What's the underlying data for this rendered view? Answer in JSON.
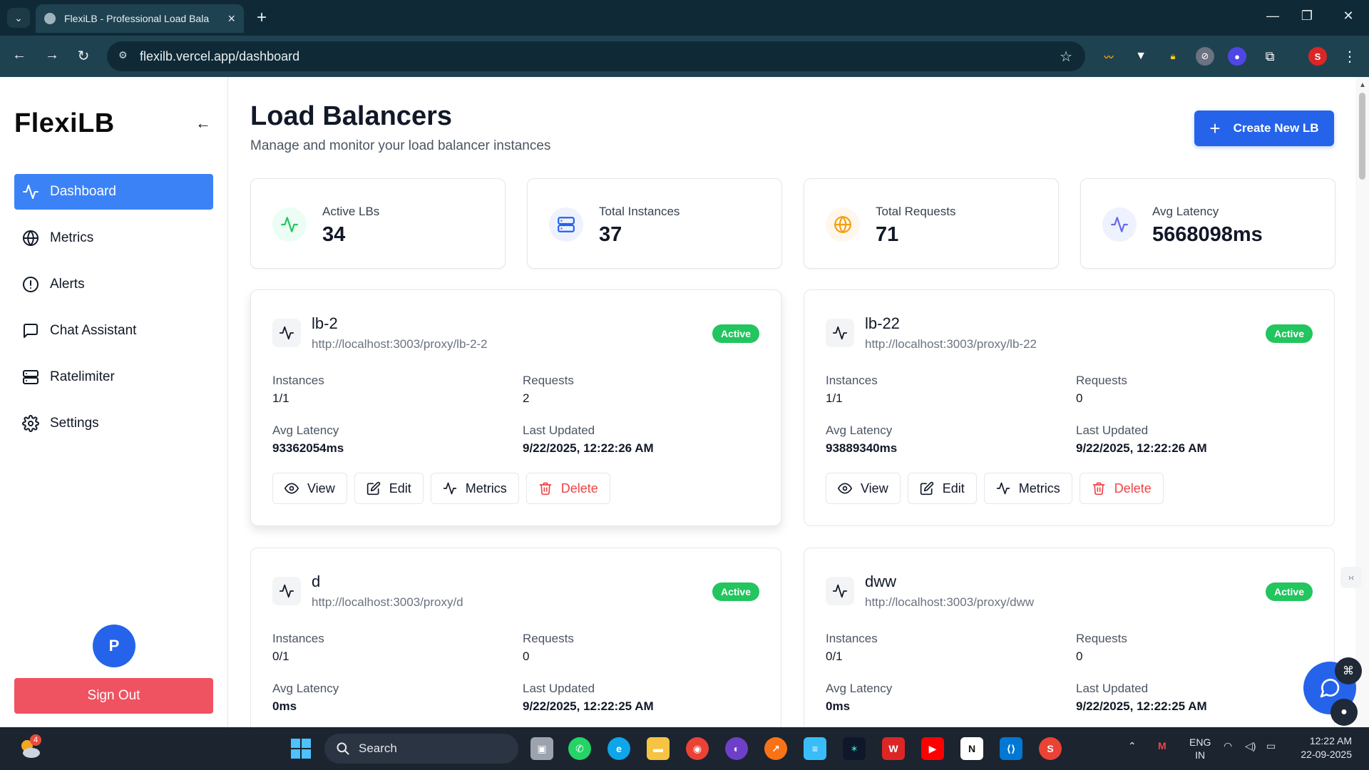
{
  "browser": {
    "tab_title": "FlexiLB - Professional Load Bala",
    "url": "flexilb.vercel.app/dashboard",
    "profile_initial": "S"
  },
  "sidebar": {
    "brand": "FlexiLB",
    "collapse_glyph": "←",
    "items": [
      {
        "label": "Dashboard",
        "icon": "activity-icon",
        "active": true
      },
      {
        "label": "Metrics",
        "icon": "globe-icon",
        "active": false
      },
      {
        "label": "Alerts",
        "icon": "alert-circle-icon",
        "active": false
      },
      {
        "label": "Chat Assistant",
        "icon": "message-square-icon",
        "active": false
      },
      {
        "label": "Ratelimiter",
        "icon": "server-icon",
        "active": false
      },
      {
        "label": "Settings",
        "icon": "gear-icon",
        "active": false
      }
    ],
    "avatar_initial": "P",
    "sign_out": "Sign Out"
  },
  "main": {
    "title": "Load Balancers",
    "subtitle": "Manage and monitor your load balancer instances",
    "create_button": "Create New LB",
    "stats": [
      {
        "label": "Active LBs",
        "value": "34",
        "icon": "activity-icon",
        "color": "#22c55e"
      },
      {
        "label": "Total Instances",
        "value": "37",
        "icon": "server-icon",
        "color": "#2563eb"
      },
      {
        "label": "Total Requests",
        "value": "71",
        "icon": "globe-icon",
        "color": "#f59e0b"
      },
      {
        "label": "Avg Latency",
        "value": "5668098ms",
        "icon": "activity-icon",
        "color": "#6366f1"
      }
    ],
    "field_labels": {
      "instances": "Instances",
      "requests": "Requests",
      "avg_latency": "Avg Latency",
      "last_updated": "Last Updated"
    },
    "actions": {
      "view": "View",
      "edit": "Edit",
      "metrics": "Metrics",
      "delete": "Delete"
    },
    "load_balancers": [
      {
        "name": "lb-2",
        "url": "http://localhost:3003/proxy/lb-2-2",
        "status": "Active",
        "instances": "1/1",
        "requests": "2",
        "avg_latency": "93362054ms",
        "last_updated": "9/22/2025, 12:22:26 AM"
      },
      {
        "name": "lb-22",
        "url": "http://localhost:3003/proxy/lb-22",
        "status": "Active",
        "instances": "1/1",
        "requests": "0",
        "avg_latency": "93889340ms",
        "last_updated": "9/22/2025, 12:22:26 AM"
      },
      {
        "name": "d",
        "url": "http://localhost:3003/proxy/d",
        "status": "Active",
        "instances": "0/1",
        "requests": "0",
        "avg_latency": "0ms",
        "last_updated": "9/22/2025, 12:22:25 AM"
      },
      {
        "name": "dww",
        "url": "http://localhost:3003/proxy/dww",
        "status": "Active",
        "instances": "0/1",
        "requests": "0",
        "avg_latency": "0ms",
        "last_updated": "9/22/2025, 12:22:25 AM"
      }
    ]
  },
  "taskbar": {
    "weather_badge": "4",
    "search_label": "Search",
    "language": "ENG",
    "region": "IN",
    "time": "12:22 AM",
    "date": "22-09-2025",
    "chrome_badge": "S"
  },
  "colors": {
    "accent": "#2563eb",
    "active_nav": "#3b82f6",
    "signout": "#ef5261",
    "badge": "#22c55e",
    "danger": "#ef4444"
  }
}
